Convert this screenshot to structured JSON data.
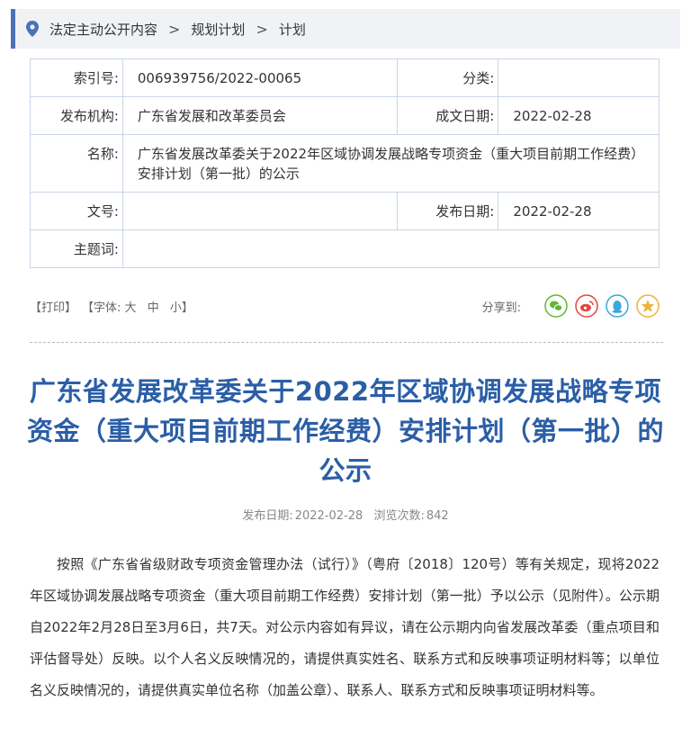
{
  "breadcrumb": {
    "items": [
      "法定主动公开内容",
      "规划计划",
      "计划"
    ],
    "separator": ">"
  },
  "meta": {
    "index_label": "索引号:",
    "index_value": "006939756/2022-00065",
    "category_label": "分类:",
    "category_value": "",
    "issuer_label": "发布机构:",
    "issuer_value": "广东省发展和改革委员会",
    "date_made_label": "成文日期:",
    "date_made_value": "2022-02-28",
    "name_label": "名称:",
    "name_value": "广东省发展改革委关于2022年区域协调发展战略专项资金（重大项目前期工作经费）安排计划（第一批）的公示",
    "doc_no_label": "文号:",
    "doc_no_value": "",
    "pub_date_label": "发布日期:",
    "pub_date_value": "2022-02-28",
    "subject_label": "主题词:",
    "subject_value": ""
  },
  "toolbar": {
    "print": "【打印】",
    "font_label": "【字体:",
    "font_large": "大",
    "font_medium": "中",
    "font_small": "小】",
    "share_label": "分享到:"
  },
  "colors": {
    "accent": "#4a72b8",
    "title": "#2b5ea6",
    "wechat": "#5fb832",
    "weibo": "#e2483d",
    "qq": "#3ba6e0",
    "qzone": "#f0b23a"
  },
  "article": {
    "title": "广东省发展改革委关于2022年区域协调发展战略专项资金（重大项目前期工作经费）安排计划（第一批）的公示",
    "pub_date_label": "发布日期:",
    "pub_date": "2022-02-28",
    "views_label": "浏览次数:",
    "views": "842",
    "body": "按照《广东省省级财政专项资金管理办法（试行）》（粤府〔2018〕120号）等有关规定，现将2022年区域协调发展战略专项资金（重大项目前期工作经费）安排计划（第一批）予以公示（见附件）。公示期自2022年2月28日至3月6日，共7天。对公示内容如有异议，请在公示期内向省发展改革委（重点项目和评估督导处）反映。以个人名义反映情况的，请提供真实姓名、联系方式和反映事项证明材料等；以单位名义反映情况的，请提供真实单位名称（加盖公章）、联系人、联系方式和反映事项证明材料等。"
  }
}
